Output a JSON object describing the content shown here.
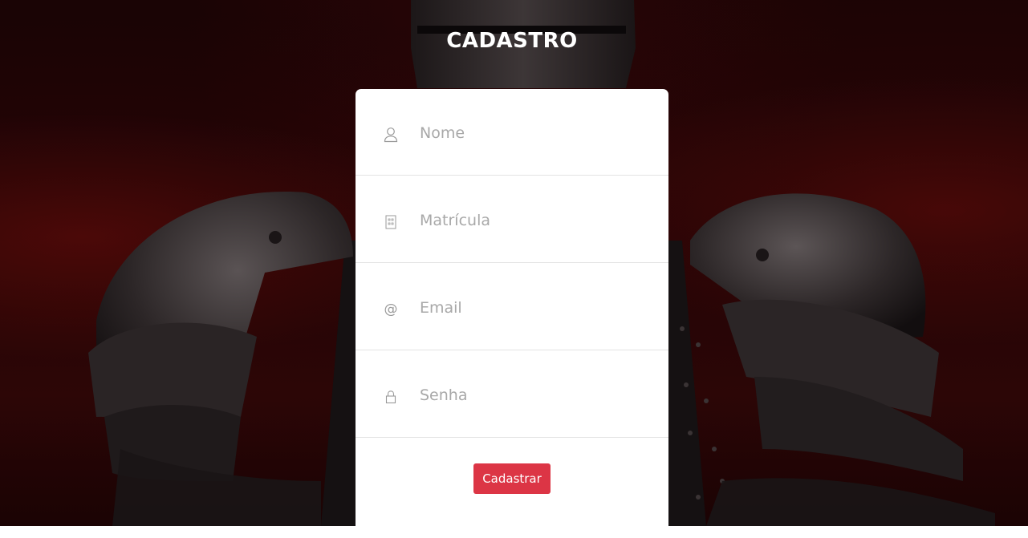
{
  "page": {
    "title": "CADASTRO"
  },
  "form": {
    "fields": [
      {
        "icon": "user-icon",
        "placeholder": "Nome",
        "value": ""
      },
      {
        "icon": "id-card-icon",
        "placeholder": "Matrícula",
        "value": ""
      },
      {
        "icon": "at-sign-icon",
        "at_glyph": "@",
        "placeholder": "Email",
        "value": ""
      },
      {
        "icon": "lock-icon",
        "placeholder": "Senha",
        "value": ""
      }
    ],
    "submit_label": "Cadastrar"
  },
  "colors": {
    "accent": "#dc3545",
    "card_background": "#ffffff",
    "page_background": "#1a0405"
  }
}
